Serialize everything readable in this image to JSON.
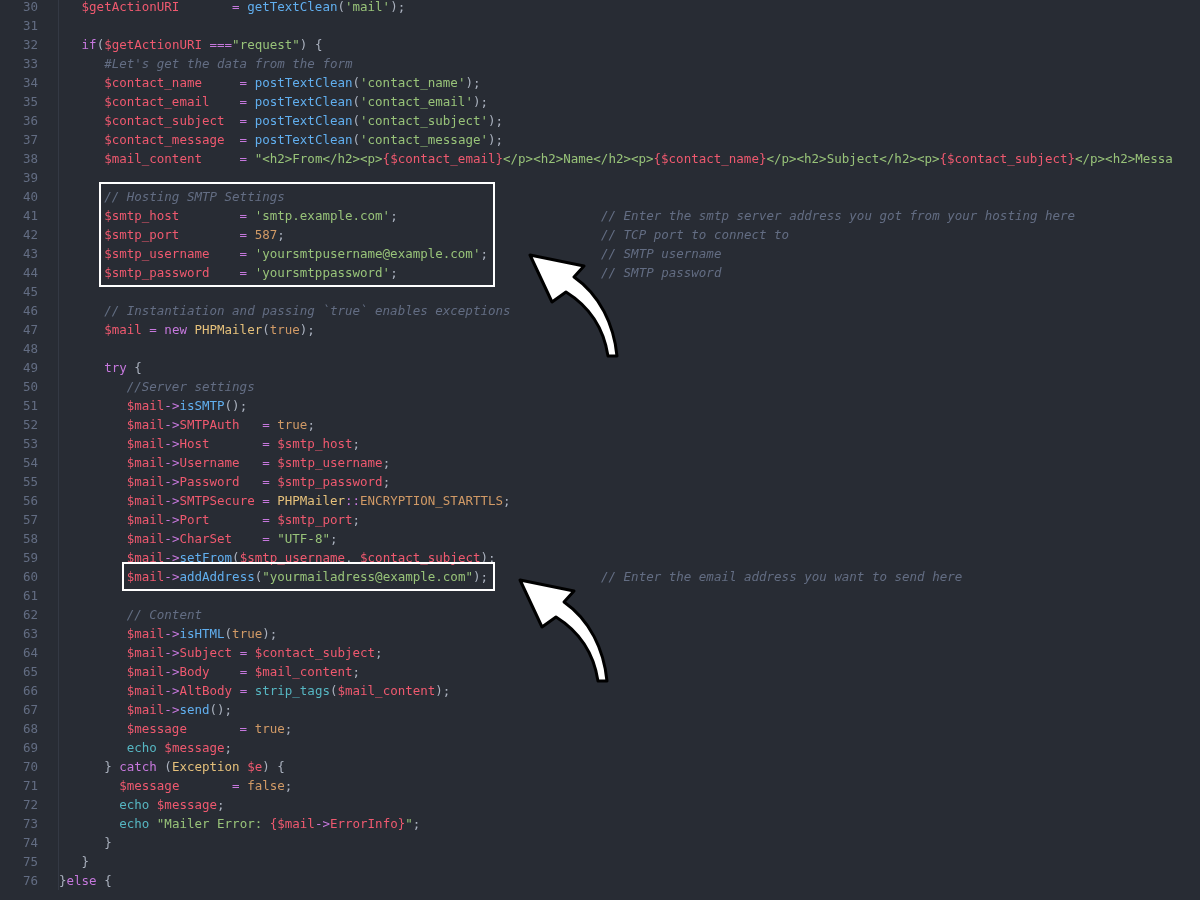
{
  "editor": {
    "lines": [
      {
        "number": "30",
        "boxed": false,
        "code": [
          {
            "kind": "var",
            "text": "   $getActionURI"
          },
          {
            "kind": "op",
            "text": "       = "
          },
          {
            "kind": "fn",
            "text": "getTextClean"
          },
          {
            "kind": "punct",
            "text": "("
          },
          {
            "kind": "str",
            "text": "'mail'"
          },
          {
            "kind": "punct",
            "text": ");"
          }
        ]
      },
      {
        "number": "31",
        "boxed": false
      },
      {
        "number": "32",
        "boxed": false,
        "code": [
          {
            "kind": "kw",
            "text": "   if"
          },
          {
            "kind": "punct",
            "text": "("
          },
          {
            "kind": "var",
            "text": "$getActionURI"
          },
          {
            "kind": "op",
            "text": " ==="
          },
          {
            "kind": "str",
            "text": "\"request\""
          },
          {
            "kind": "punct",
            "text": ") {"
          }
        ]
      },
      {
        "number": "33",
        "boxed": false,
        "code": [
          {
            "kind": "comment",
            "text": "      #Let's get the data from the form"
          }
        ]
      },
      {
        "number": "34",
        "boxed": false,
        "code": [
          {
            "kind": "var",
            "text": "      $contact_name"
          },
          {
            "kind": "op",
            "text": "     = "
          },
          {
            "kind": "fn",
            "text": "postTextClean"
          },
          {
            "kind": "punct",
            "text": "("
          },
          {
            "kind": "str",
            "text": "'contact_name'"
          },
          {
            "kind": "punct",
            "text": ");"
          }
        ]
      },
      {
        "number": "35",
        "boxed": false,
        "code": [
          {
            "kind": "var",
            "text": "      $contact_email"
          },
          {
            "kind": "op",
            "text": "    = "
          },
          {
            "kind": "fn",
            "text": "postTextClean"
          },
          {
            "kind": "punct",
            "text": "("
          },
          {
            "kind": "str",
            "text": "'contact_email'"
          },
          {
            "kind": "punct",
            "text": ");"
          }
        ]
      },
      {
        "number": "36",
        "boxed": false,
        "code": [
          {
            "kind": "var",
            "text": "      $contact_subject"
          },
          {
            "kind": "op",
            "text": "  = "
          },
          {
            "kind": "fn",
            "text": "postTextClean"
          },
          {
            "kind": "punct",
            "text": "("
          },
          {
            "kind": "str",
            "text": "'contact_subject'"
          },
          {
            "kind": "punct",
            "text": ");"
          }
        ]
      },
      {
        "number": "37",
        "boxed": false,
        "code": [
          {
            "kind": "var",
            "text": "      $contact_message"
          },
          {
            "kind": "op",
            "text": "  = "
          },
          {
            "kind": "fn",
            "text": "postTextClean"
          },
          {
            "kind": "punct",
            "text": "("
          },
          {
            "kind": "str",
            "text": "'contact_message'"
          },
          {
            "kind": "punct",
            "text": ");"
          }
        ]
      },
      {
        "number": "38",
        "boxed": false,
        "code": [
          {
            "kind": "var",
            "text": "      $mail_content"
          },
          {
            "kind": "op",
            "text": "     = "
          },
          {
            "kind": "str",
            "text": "\"<h2>From</h2><p>"
          },
          {
            "kind": "var",
            "text": "{$contact_email}"
          },
          {
            "kind": "str",
            "text": "</p><h2>Name</h2><p>"
          },
          {
            "kind": "var",
            "text": "{$contact_name}"
          },
          {
            "kind": "str",
            "text": "</p><h2>Subject</h2><p>"
          },
          {
            "kind": "var",
            "text": "{$contact_subject}"
          },
          {
            "kind": "str",
            "text": "</p><h2>Messa"
          }
        ]
      },
      {
        "number": "39",
        "boxed": false
      },
      {
        "number": "40",
        "boxed": true,
        "code": [
          {
            "kind": "comment",
            "text": "      // Hosting SMTP Settings"
          }
        ]
      },
      {
        "number": "41",
        "boxed": true,
        "code": [
          {
            "kind": "var",
            "text": "      $smtp_host"
          },
          {
            "kind": "op",
            "text": "        = "
          },
          {
            "kind": "str",
            "text": "'smtp.example.com'"
          },
          {
            "kind": "punct",
            "text": ";"
          }
        ],
        "note": "// Enter the smtp server address you got from your hosting here"
      },
      {
        "number": "42",
        "boxed": true,
        "code": [
          {
            "kind": "var",
            "text": "      $smtp_port"
          },
          {
            "kind": "op",
            "text": "        = "
          },
          {
            "kind": "num",
            "text": "587"
          },
          {
            "kind": "punct",
            "text": ";"
          }
        ],
        "note": "// TCP port to connect to"
      },
      {
        "number": "43",
        "boxed": true,
        "code": [
          {
            "kind": "var",
            "text": "      $smtp_username"
          },
          {
            "kind": "op",
            "text": "    = "
          },
          {
            "kind": "str",
            "text": "'yoursmtpusername@example.com'"
          },
          {
            "kind": "punct",
            "text": ";"
          }
        ],
        "note": "// SMTP username"
      },
      {
        "number": "44",
        "boxed": true,
        "code": [
          {
            "kind": "var",
            "text": "      $smtp_password"
          },
          {
            "kind": "op",
            "text": "    = "
          },
          {
            "kind": "str",
            "text": "'yoursmtppassword'"
          },
          {
            "kind": "punct",
            "text": ";"
          }
        ],
        "note": "// SMTP password"
      },
      {
        "number": "45",
        "boxed": false
      },
      {
        "number": "46",
        "boxed": false,
        "code": [
          {
            "kind": "comment",
            "text": "      // Instantiation and passing `true` enables exceptions"
          }
        ]
      },
      {
        "number": "47",
        "boxed": false,
        "code": [
          {
            "kind": "var",
            "text": "      $mail"
          },
          {
            "kind": "op",
            "text": " = "
          },
          {
            "kind": "kw",
            "text": "new "
          },
          {
            "kind": "class",
            "text": "PHPMailer"
          },
          {
            "kind": "punct",
            "text": "("
          },
          {
            "kind": "num",
            "text": "true"
          },
          {
            "kind": "punct",
            "text": ");"
          }
        ]
      },
      {
        "number": "48",
        "boxed": false
      },
      {
        "number": "49",
        "boxed": false,
        "code": [
          {
            "kind": "kw",
            "text": "      try"
          },
          {
            "kind": "punct",
            "text": " {"
          }
        ]
      },
      {
        "number": "50",
        "boxed": false,
        "code": [
          {
            "kind": "comment",
            "text": "         //Server settings"
          }
        ]
      },
      {
        "number": "51",
        "boxed": false,
        "code": [
          {
            "kind": "var",
            "text": "         $mail"
          },
          {
            "kind": "op",
            "text": "->"
          },
          {
            "kind": "fn",
            "text": "isSMTP"
          },
          {
            "kind": "punct",
            "text": "();"
          }
        ]
      },
      {
        "number": "52",
        "boxed": false,
        "code": [
          {
            "kind": "var",
            "text": "         $mail"
          },
          {
            "kind": "op",
            "text": "->"
          },
          {
            "kind": "var",
            "text": "SMTPAuth"
          },
          {
            "kind": "op",
            "text": "   = "
          },
          {
            "kind": "num",
            "text": "true"
          },
          {
            "kind": "punct",
            "text": ";"
          }
        ]
      },
      {
        "number": "53",
        "boxed": false,
        "code": [
          {
            "kind": "var",
            "text": "         $mail"
          },
          {
            "kind": "op",
            "text": "->"
          },
          {
            "kind": "var",
            "text": "Host"
          },
          {
            "kind": "op",
            "text": "       = "
          },
          {
            "kind": "var",
            "text": "$smtp_host"
          },
          {
            "kind": "punct",
            "text": ";"
          }
        ]
      },
      {
        "number": "54",
        "boxed": false,
        "code": [
          {
            "kind": "var",
            "text": "         $mail"
          },
          {
            "kind": "op",
            "text": "->"
          },
          {
            "kind": "var",
            "text": "Username"
          },
          {
            "kind": "op",
            "text": "   = "
          },
          {
            "kind": "var",
            "text": "$smtp_username"
          },
          {
            "kind": "punct",
            "text": ";"
          }
        ]
      },
      {
        "number": "55",
        "boxed": false,
        "code": [
          {
            "kind": "var",
            "text": "         $mail"
          },
          {
            "kind": "op",
            "text": "->"
          },
          {
            "kind": "var",
            "text": "Password"
          },
          {
            "kind": "op",
            "text": "   = "
          },
          {
            "kind": "var",
            "text": "$smtp_password"
          },
          {
            "kind": "punct",
            "text": ";"
          }
        ]
      },
      {
        "number": "56",
        "boxed": false,
        "code": [
          {
            "kind": "var",
            "text": "         $mail"
          },
          {
            "kind": "op",
            "text": "->"
          },
          {
            "kind": "var",
            "text": "SMTPSecure"
          },
          {
            "kind": "op",
            "text": " = "
          },
          {
            "kind": "class",
            "text": "PHPMailer"
          },
          {
            "kind": "op",
            "text": "::"
          },
          {
            "kind": "num",
            "text": "ENCRYPTION_STARTTLS"
          },
          {
            "kind": "punct",
            "text": ";"
          }
        ]
      },
      {
        "number": "57",
        "boxed": false,
        "code": [
          {
            "kind": "var",
            "text": "         $mail"
          },
          {
            "kind": "op",
            "text": "->"
          },
          {
            "kind": "var",
            "text": "Port"
          },
          {
            "kind": "op",
            "text": "       = "
          },
          {
            "kind": "var",
            "text": "$smtp_port"
          },
          {
            "kind": "punct",
            "text": ";"
          }
        ]
      },
      {
        "number": "58",
        "boxed": false,
        "code": [
          {
            "kind": "var",
            "text": "         $mail"
          },
          {
            "kind": "op",
            "text": "->"
          },
          {
            "kind": "var",
            "text": "CharSet"
          },
          {
            "kind": "op",
            "text": "    = "
          },
          {
            "kind": "str",
            "text": "\"UTF-8\""
          },
          {
            "kind": "punct",
            "text": ";"
          }
        ]
      },
      {
        "number": "59",
        "boxed": false,
        "code": [
          {
            "kind": "var",
            "text": "         $mail"
          },
          {
            "kind": "op",
            "text": "->"
          },
          {
            "kind": "fn",
            "text": "setFrom"
          },
          {
            "kind": "punct",
            "text": "("
          },
          {
            "kind": "var",
            "text": "$smtp_username"
          },
          {
            "kind": "punct",
            "text": ", "
          },
          {
            "kind": "var",
            "text": "$contact_subject"
          },
          {
            "kind": "punct",
            "text": ");"
          }
        ]
      },
      {
        "number": "60",
        "boxed": true,
        "code": [
          {
            "kind": "var",
            "text": "         $mail"
          },
          {
            "kind": "op",
            "text": "->"
          },
          {
            "kind": "fn",
            "text": "addAddress"
          },
          {
            "kind": "punct",
            "text": "("
          },
          {
            "kind": "str",
            "text": "\"yourmailadress@example.com\""
          },
          {
            "kind": "punct",
            "text": ");"
          }
        ],
        "note": "// Enter the email address you want to send here"
      },
      {
        "number": "61",
        "boxed": false
      },
      {
        "number": "62",
        "boxed": false,
        "code": [
          {
            "kind": "comment",
            "text": "         // Content"
          }
        ]
      },
      {
        "number": "63",
        "boxed": false,
        "code": [
          {
            "kind": "var",
            "text": "         $mail"
          },
          {
            "kind": "op",
            "text": "->"
          },
          {
            "kind": "fn",
            "text": "isHTML"
          },
          {
            "kind": "punct",
            "text": "("
          },
          {
            "kind": "num",
            "text": "true"
          },
          {
            "kind": "punct",
            "text": ");"
          }
        ]
      },
      {
        "number": "64",
        "boxed": false,
        "code": [
          {
            "kind": "var",
            "text": "         $mail"
          },
          {
            "kind": "op",
            "text": "->"
          },
          {
            "kind": "var",
            "text": "Subject"
          },
          {
            "kind": "op",
            "text": " = "
          },
          {
            "kind": "var",
            "text": "$contact_subject"
          },
          {
            "kind": "punct",
            "text": ";"
          }
        ]
      },
      {
        "number": "65",
        "boxed": false,
        "code": [
          {
            "kind": "var",
            "text": "         $mail"
          },
          {
            "kind": "op",
            "text": "->"
          },
          {
            "kind": "var",
            "text": "Body"
          },
          {
            "kind": "op",
            "text": "    = "
          },
          {
            "kind": "var",
            "text": "$mail_content"
          },
          {
            "kind": "punct",
            "text": ";"
          }
        ]
      },
      {
        "number": "66",
        "boxed": false,
        "code": [
          {
            "kind": "var",
            "text": "         $mail"
          },
          {
            "kind": "op",
            "text": "->"
          },
          {
            "kind": "var",
            "text": "AltBody"
          },
          {
            "kind": "op",
            "text": " = "
          },
          {
            "kind": "builtin",
            "text": "strip_tags"
          },
          {
            "kind": "punct",
            "text": "("
          },
          {
            "kind": "var",
            "text": "$mail_content"
          },
          {
            "kind": "punct",
            "text": ");"
          }
        ]
      },
      {
        "number": "67",
        "boxed": false,
        "code": [
          {
            "kind": "var",
            "text": "         $mail"
          },
          {
            "kind": "op",
            "text": "->"
          },
          {
            "kind": "fn",
            "text": "send"
          },
          {
            "kind": "punct",
            "text": "();"
          }
        ]
      },
      {
        "number": "68",
        "boxed": false,
        "code": [
          {
            "kind": "var",
            "text": "         $message"
          },
          {
            "kind": "op",
            "text": "       = "
          },
          {
            "kind": "num",
            "text": "true"
          },
          {
            "kind": "punct",
            "text": ";"
          }
        ]
      },
      {
        "number": "69",
        "boxed": false,
        "code": [
          {
            "kind": "builtin",
            "text": "         echo "
          },
          {
            "kind": "var",
            "text": "$message"
          },
          {
            "kind": "punct",
            "text": ";"
          }
        ]
      },
      {
        "number": "70",
        "boxed": false,
        "code": [
          {
            "kind": "punct",
            "text": "      } "
          },
          {
            "kind": "kw",
            "text": "catch "
          },
          {
            "kind": "punct",
            "text": "("
          },
          {
            "kind": "class",
            "text": "Exception "
          },
          {
            "kind": "var",
            "text": "$e"
          },
          {
            "kind": "punct",
            "text": ") {"
          }
        ]
      },
      {
        "number": "71",
        "boxed": false,
        "code": [
          {
            "kind": "var",
            "text": "        $message"
          },
          {
            "kind": "op",
            "text": "       = "
          },
          {
            "kind": "num",
            "text": "false"
          },
          {
            "kind": "punct",
            "text": ";"
          }
        ]
      },
      {
        "number": "72",
        "boxed": false,
        "code": [
          {
            "kind": "builtin",
            "text": "        echo "
          },
          {
            "kind": "var",
            "text": "$message"
          },
          {
            "kind": "punct",
            "text": ";"
          }
        ]
      },
      {
        "number": "73",
        "boxed": false,
        "code": [
          {
            "kind": "builtin",
            "text": "        echo "
          },
          {
            "kind": "str",
            "text": "\"Mailer Error: "
          },
          {
            "kind": "var",
            "text": "{$mail"
          },
          {
            "kind": "op",
            "text": "->"
          },
          {
            "kind": "var",
            "text": "ErrorInfo}"
          },
          {
            "kind": "str",
            "text": "\""
          },
          {
            "kind": "punct",
            "text": ";"
          }
        ]
      },
      {
        "number": "74",
        "boxed": false,
        "code": [
          {
            "kind": "punct",
            "text": "      }"
          }
        ]
      },
      {
        "number": "75",
        "boxed": false,
        "code": [
          {
            "kind": "punct",
            "text": "   }"
          }
        ]
      },
      {
        "number": "76",
        "boxed": false,
        "code": [
          {
            "kind": "punct",
            "text": "}"
          },
          {
            "kind": "kw",
            "text": "else"
          },
          {
            "kind": "punct",
            "text": " {"
          }
        ]
      }
    ]
  }
}
